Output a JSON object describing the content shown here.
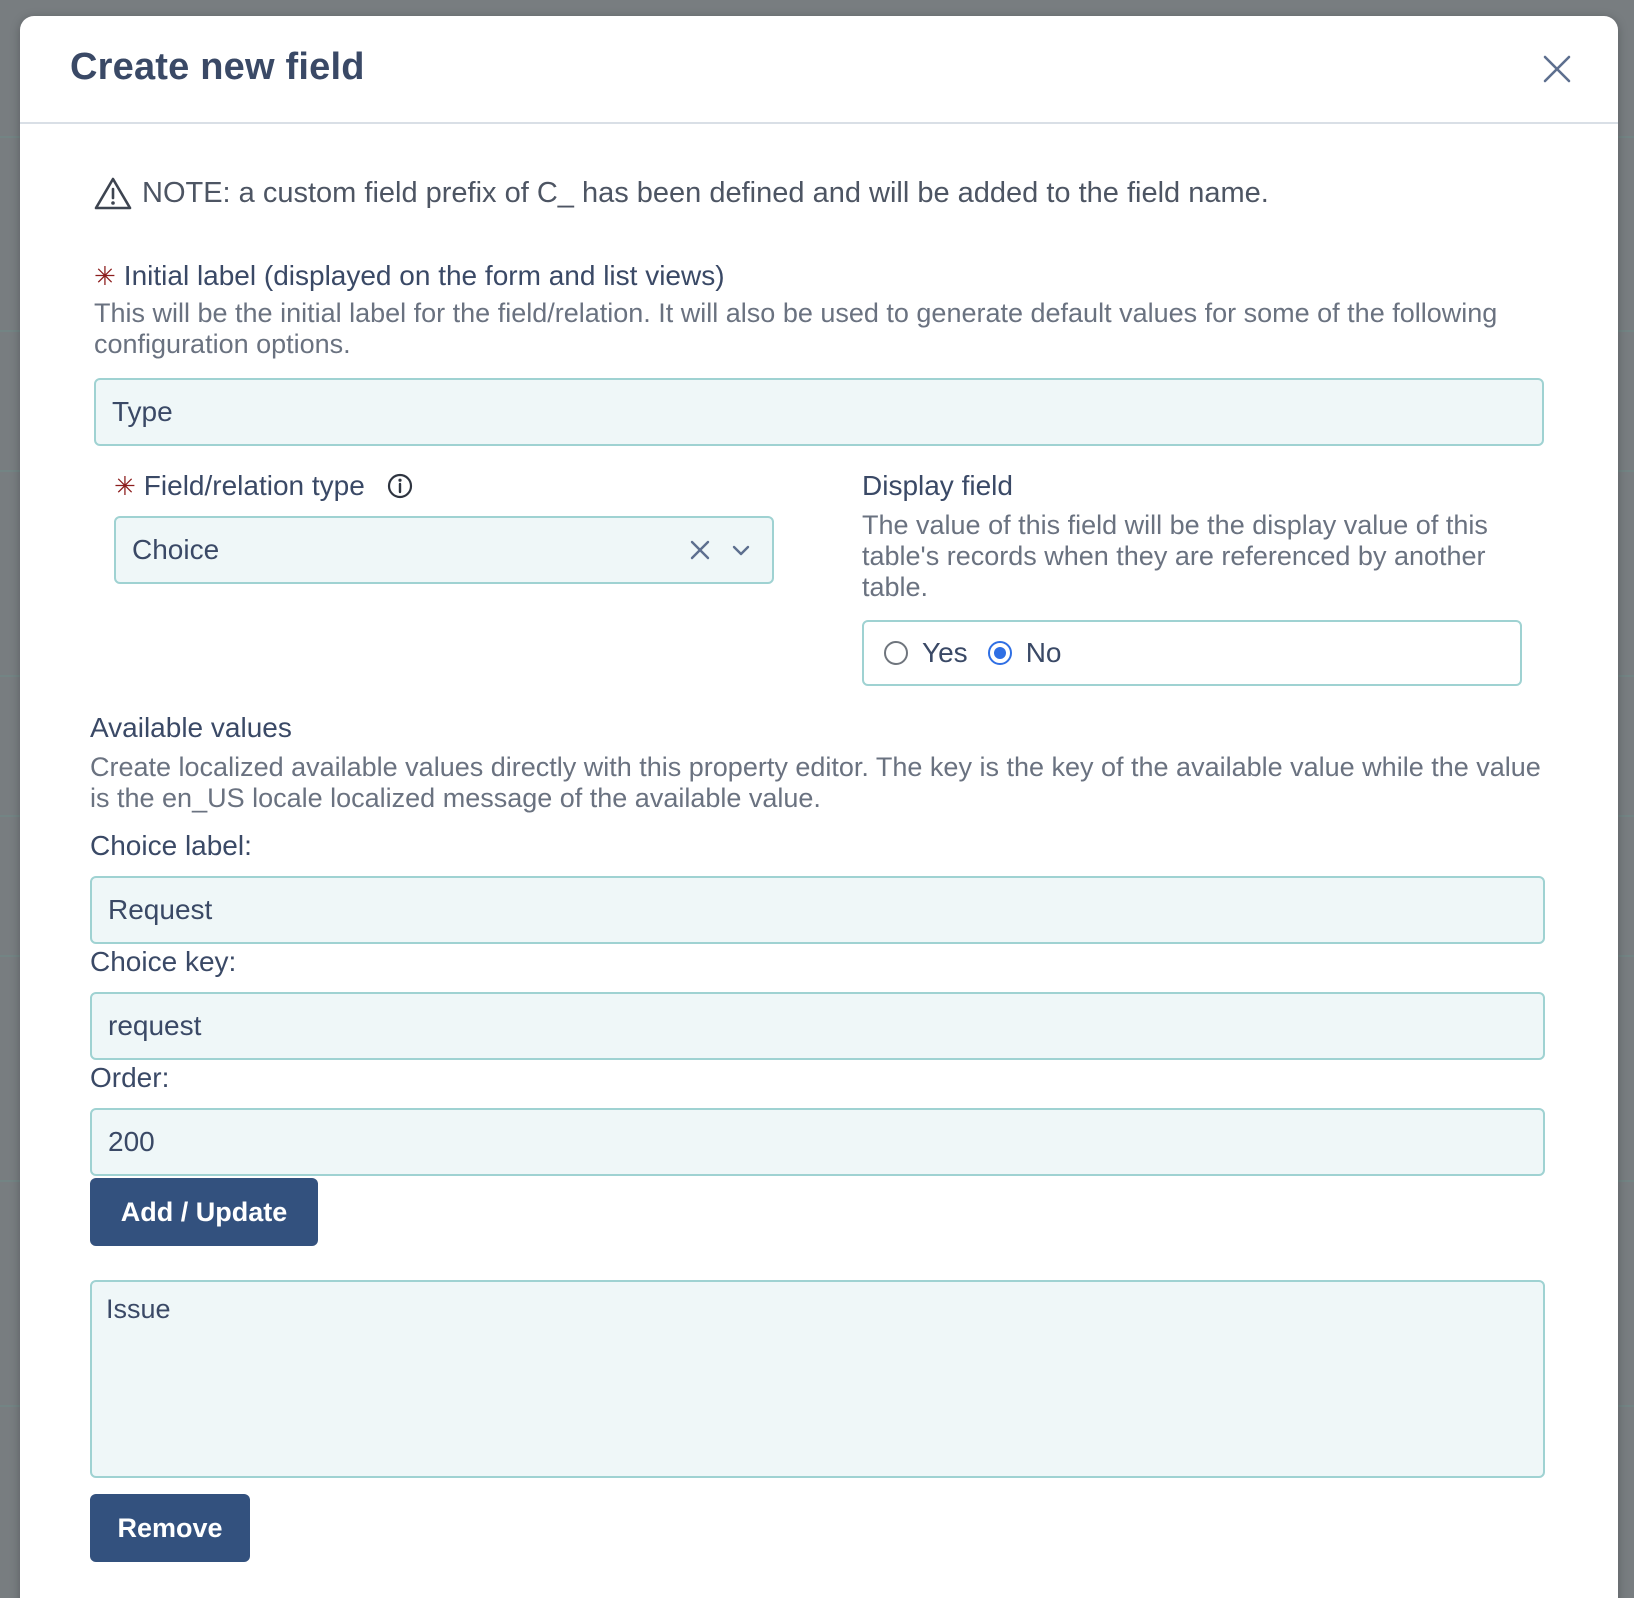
{
  "dialog": {
    "title": "Create new field",
    "note": "NOTE: a custom field prefix of C_ has been defined and will be added to the field name."
  },
  "initial_label": {
    "label": "Initial label (displayed on the form and list views)",
    "help": "This will be the initial label for the field/relation. It will also be used to generate default values for some of the following configuration options.",
    "value": "Type"
  },
  "field_type": {
    "label": "Field/relation type",
    "value": "Choice"
  },
  "display_field": {
    "label": "Display field",
    "help": "The value of this field will be the display value of this table's records when they are referenced by another table.",
    "options": [
      "Yes",
      "No"
    ],
    "selected": "No"
  },
  "available_values": {
    "title": "Available values",
    "help": "Create localized available values directly with this property editor. The key is the key of the available value while the value is the en_US locale localized message of the available value.",
    "choice_label_label": "Choice label:",
    "choice_label_value": "Request",
    "choice_key_label": "Choice key:",
    "choice_key_value": "request",
    "order_label": "Order:",
    "order_value": "200",
    "add_update_button": "Add / Update",
    "list_items": [
      "Issue"
    ],
    "remove_button": "Remove"
  },
  "colors": {
    "title": "#3a4966",
    "primary_button": "#33517e",
    "input_bg": "#eff7f8",
    "input_border": "#9fd2d2",
    "required": "#8c1d1d",
    "radio_checked": "#2f6fe4"
  }
}
